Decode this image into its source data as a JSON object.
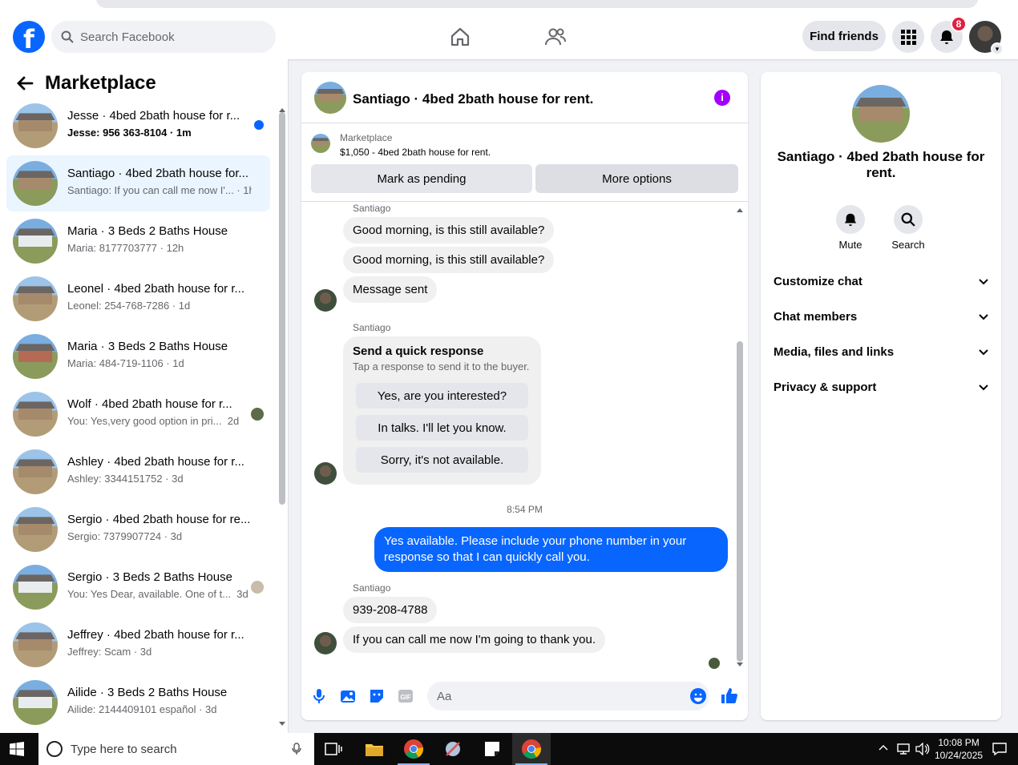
{
  "topbar": {
    "logo_letter": "f",
    "search_placeholder": "Search Facebook",
    "find_friends": "Find friends",
    "notifications_count": "8"
  },
  "marketplace": {
    "title": "Marketplace",
    "conversations": [
      {
        "name": "Jesse · 4bed 2bath house for r...",
        "preview": "Jesse: 956 363-8104",
        "time": "1m",
        "unread": true
      },
      {
        "name": "Santiago · 4bed 2bath house for...",
        "preview": "Santiago: If you can call me now I'...",
        "time": "1h",
        "active": true
      },
      {
        "name": "Maria · 3 Beds 2 Baths House",
        "preview": "Maria: 8177703777",
        "time": "12h"
      },
      {
        "name": "Leonel · 4bed 2bath house for r...",
        "preview": "Leonel: 254-768-7286",
        "time": "1d"
      },
      {
        "name": "Maria · 3 Beds 2 Baths House",
        "preview": "Maria: 484-719-1106",
        "time": "1d"
      },
      {
        "name": "Wolf · 4bed 2bath house for r...",
        "preview": "You: Yes,very good option in pri...",
        "time": "2d"
      },
      {
        "name": "Ashley · 4bed 2bath house for r...",
        "preview": "Ashley: 3344151752",
        "time": "3d"
      },
      {
        "name": "Sergio · 4bed 2bath house for re...",
        "preview": "Sergio: 7379907724",
        "time": "3d"
      },
      {
        "name": "Sergio · 3 Beds 2 Baths House",
        "preview": "You: Yes Dear, available. One of t...",
        "time": "3d"
      },
      {
        "name": "Jeffrey · 4bed 2bath house for r...",
        "preview": "Jeffrey: Scam",
        "time": "3d"
      },
      {
        "name": "Ailide · 3 Beds 2 Baths House",
        "preview": "Ailide: 2144409101 español",
        "time": "3d"
      }
    ]
  },
  "chat": {
    "title": "Santiago · 4bed 2bath house for rent.",
    "info_glyph": "i",
    "listing_label": "Marketplace",
    "listing_price": "$1,050 - 4bed 2bath house for rent.",
    "mark_pending": "Mark as pending",
    "more_options": "More options",
    "sender_name": "Santiago",
    "messages": {
      "m1": "Good morning, is this still available?",
      "m2": "Good morning, is this still available?",
      "m3": "Message sent",
      "quick_title": "Send a quick response",
      "quick_sub": "Tap a response to send it to the buyer.",
      "quick_options": [
        "Yes, are you interested?",
        "In talks. I'll let you know.",
        "Sorry, it's not available."
      ],
      "timestamp": "8:54 PM",
      "me1": "Yes available. Please include your phone number in your response so that I can quickly call you.",
      "m4": "939-208-4788",
      "m5": "If you can call me now I'm going to thank you."
    },
    "composer_placeholder": "Aa"
  },
  "details": {
    "title": "Santiago · 4bed 2bath house for rent.",
    "mute": "Mute",
    "search": "Search",
    "sections": [
      "Customize chat",
      "Chat members",
      "Media, files and links",
      "Privacy & support"
    ]
  },
  "taskbar": {
    "search_placeholder": "Type here to search",
    "time": "10:08 PM",
    "date": "10/24/2025"
  },
  "colors": {
    "accent": "#0866ff",
    "info": "#a100ff",
    "badge": "#e41e3f"
  }
}
